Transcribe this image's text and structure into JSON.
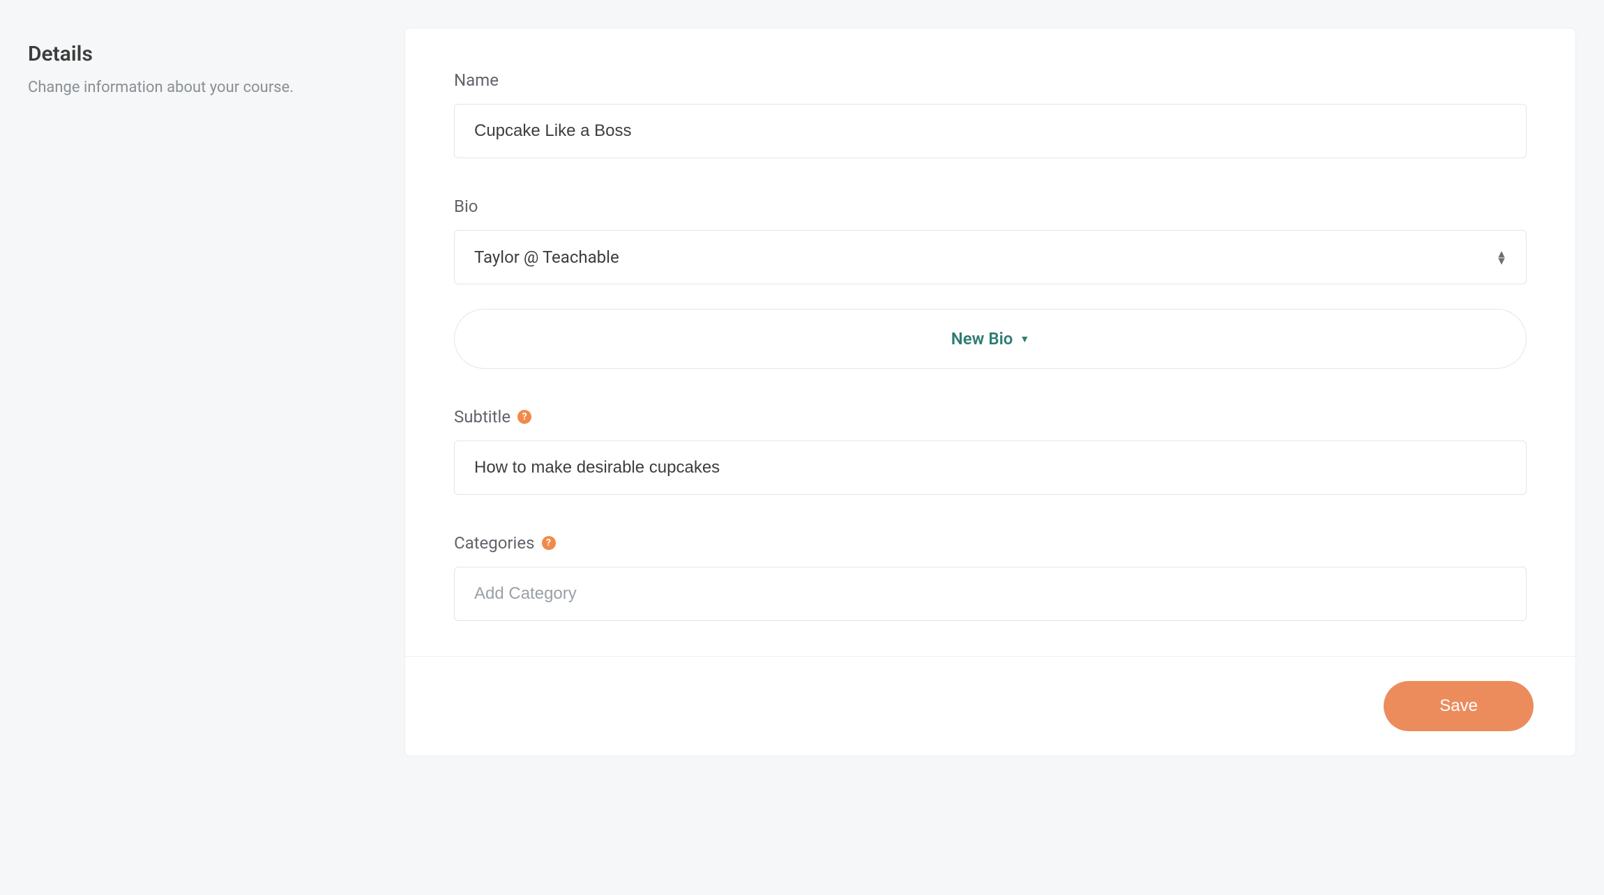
{
  "sidebar": {
    "title": "Details",
    "description": "Change information about your course."
  },
  "form": {
    "name_label": "Name",
    "name_value": "Cupcake Like a Boss",
    "bio_label": "Bio",
    "bio_selected": "Taylor @ Teachable",
    "new_bio_label": "New Bio",
    "subtitle_label": "Subtitle",
    "subtitle_value": "How to make desirable cupcakes",
    "categories_label": "Categories",
    "categories_placeholder": "Add Category"
  },
  "footer": {
    "save_label": "Save"
  }
}
